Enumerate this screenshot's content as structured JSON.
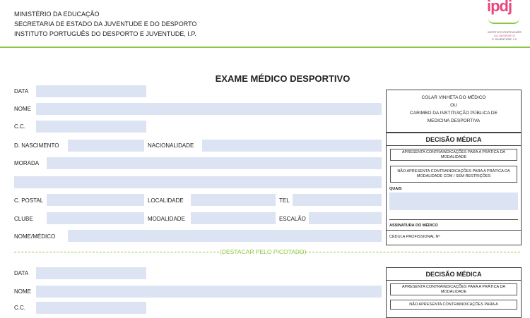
{
  "header": {
    "line1": "MINISTÉRIO DA EDUCAÇÃO",
    "line2": "SECRETARIA DE ESTADO DA JUVENTUDE E DO DESPORTO",
    "line3": "INSTITUTO PORTUGUÊS DO DESPORTO E JUVENTUDE, I.P."
  },
  "logo": {
    "mark": "ipdj",
    "line1": "INSTITUTO PORTUGUÊS",
    "line2": "DO DESPORTO",
    "line3": "E JUVENTUDE, I.P."
  },
  "form": {
    "title": "EXAME MÉDICO DESPORTIVO",
    "labels": {
      "data": "DATA",
      "nome": "NOME",
      "cc": "C.C.",
      "nascimento": "D. NASCIMENTO",
      "nacionalidade": "NACIONALIDADE",
      "morada": "MORADA",
      "postal": "C. POSTAL",
      "localidade": "LOCALIDADE",
      "tel": "TEL",
      "clube": "CLUBE",
      "modalidade": "MODALIDADE",
      "escalao": "ESCALÃO",
      "nome_medico": "NOME/MÉDICO"
    }
  },
  "stamp": {
    "line1": "COLAR VINHETA DO MÉDICO",
    "line2": "OU",
    "line3": "CARIMBO DA INSTITUIÇÃO PÚBLICA DE",
    "line4": "MEDICINA DESPORTIVA"
  },
  "decision": {
    "title": "DECISÃO MÉDICA",
    "option1": "APRESENTA CONTRAINDICAÇÕES PARA A PRÁTICA DA MODALIDADE",
    "option2": "NÃO APRESENTA CONTRAINDICAÇÕES PARA A PRÁTICA DA MODALIDADE COM / SEM RESTRIÇÕES",
    "option2_short": "NÃO APRESENTA CONTRAINDICAÇÕES PARA A",
    "quais": "QUAIS",
    "assinatura": "ASSINATURA DO MÉDICO",
    "cedula": "CÉDULA PROFISSIONAL Nº"
  },
  "cut_line": "(DESTACAR PELO PICOTADO)",
  "colors": {
    "accent_green": "#8dc63f",
    "field_bg": "#dce3f3"
  }
}
